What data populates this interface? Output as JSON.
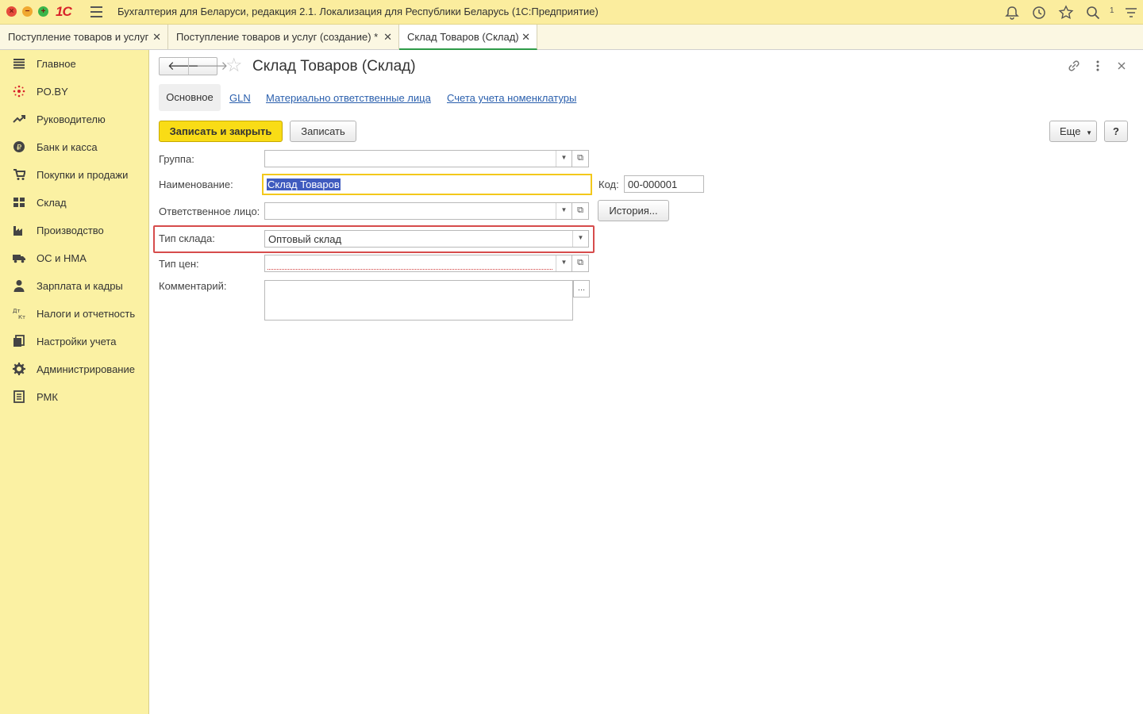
{
  "window": {
    "logo": "1С",
    "title": "Бухгалтерия для Беларуси, редакция 2.1. Локализация для Республики Беларусь   (1С:Предприятие)",
    "notification_count": "1"
  },
  "tabs": [
    {
      "label": "Поступление товаров и услуг"
    },
    {
      "label": "Поступление товаров и услуг (создание) *"
    },
    {
      "label": "Склад Товаров (Склад)"
    }
  ],
  "sidebar": {
    "items": [
      {
        "label": "Главное",
        "icon": "list-icon"
      },
      {
        "label": "PO.BY",
        "icon": "poby-icon"
      },
      {
        "label": "Руководителю",
        "icon": "trend-icon"
      },
      {
        "label": "Банк и касса",
        "icon": "coin-icon"
      },
      {
        "label": "Покупки и продажи",
        "icon": "cart-icon"
      },
      {
        "label": "Склад",
        "icon": "warehouse-icon"
      },
      {
        "label": "Производство",
        "icon": "factory-icon"
      },
      {
        "label": "ОС и НМА",
        "icon": "truck-icon"
      },
      {
        "label": "Зарплата и кадры",
        "icon": "person-icon"
      },
      {
        "label": "Налоги и отчетность",
        "icon": "dt-kt-icon"
      },
      {
        "label": "Настройки учета",
        "icon": "settings-doc-icon"
      },
      {
        "label": "Администрирование",
        "icon": "gear-icon"
      },
      {
        "label": "РМК",
        "icon": "register-icon"
      }
    ]
  },
  "form": {
    "title": "Склад Товаров (Склад)",
    "subtabs": {
      "main": "Основное",
      "links": [
        "GLN",
        "Материально ответственные лица",
        "Счета учета номенклатуры"
      ]
    },
    "toolbar": {
      "save_close": "Записать и закрыть",
      "save": "Записать",
      "more": "Еще",
      "help": "?"
    },
    "fields": {
      "group_label": "Группа:",
      "group_value": "",
      "name_label": "Наименование:",
      "name_value": "Склад Товаров",
      "code_label": "Код:",
      "code_value": "00-000001",
      "responsible_label": "Ответственное лицо:",
      "responsible_value": "",
      "history_button": "История...",
      "warehouse_type_label": "Тип склада:",
      "warehouse_type_value": "Оптовый склад",
      "price_type_label": "Тип цен:",
      "price_type_value": "",
      "comment_label": "Комментарий:",
      "comment_value": ""
    }
  },
  "colors": {
    "titlebar": "#fbed9e",
    "sidebar": "#fbf1a3",
    "primary_button": "#f9dc16",
    "active_tab_underline": "#2e9b48",
    "highlight_frame": "#d64c4c",
    "link": "#2a5fad"
  }
}
